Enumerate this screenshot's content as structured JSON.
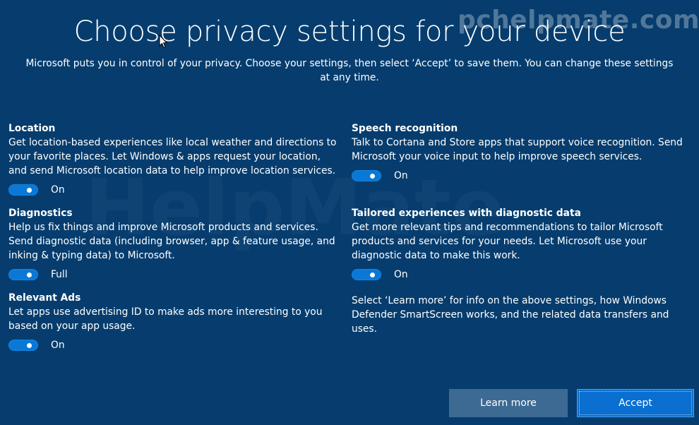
{
  "watermark": {
    "top_text": "pchelpmate.com",
    "center_text": "HelpMate"
  },
  "header": {
    "title": "Choose privacy settings for your device",
    "subtitle": "Microsoft puts you in control of your privacy. Choose your settings, then select ‘Accept’ to save them. You can change these settings at any time."
  },
  "settings": {
    "location": {
      "title": "Location",
      "description": "Get location-based experiences like local weather and directions to your favorite places. Let Windows & apps request your location, and send Microsoft location data to help improve location services.",
      "state": "On"
    },
    "diagnostics": {
      "title": "Diagnostics",
      "description": "Help us fix things and improve Microsoft products and services. Send diagnostic data (including browser, app & feature usage, and inking & typing data) to Microsoft.",
      "state": "Full"
    },
    "relevant_ads": {
      "title": "Relevant Ads",
      "description": "Let apps use advertising ID to make ads more interesting to you based on your app usage.",
      "state": "On"
    },
    "speech": {
      "title": "Speech recognition",
      "description": "Talk to Cortana and Store apps that support voice recognition. Send Microsoft your voice input to help improve speech services.",
      "state": "On"
    },
    "tailored": {
      "title": "Tailored experiences with diagnostic data",
      "description": "Get more relevant tips and recommendations to tailor Microsoft products and services for your needs. Let Microsoft use your diagnostic data to make this work.",
      "state": "On"
    }
  },
  "info": {
    "learn_more_text": "Select ‘Learn more’ for info on the above settings, how Windows Defender SmartScreen works, and the related data transfers and uses."
  },
  "buttons": {
    "learn_more": "Learn more",
    "accept": "Accept"
  },
  "colors": {
    "background": "#063d6e",
    "toggle_on": "#0a78d7",
    "learn_button": "#3d6a93",
    "accept_button": "#0a6fd0"
  },
  "icons": {
    "cursor": "mouse-pointer-icon"
  }
}
